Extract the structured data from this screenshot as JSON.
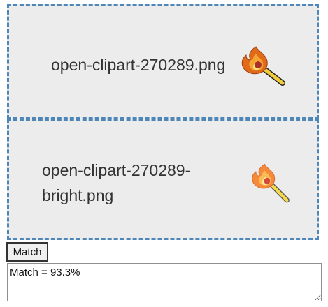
{
  "zones": [
    {
      "filename": "open-clipart-270289.png",
      "thumb_icon": "burning-match-icon"
    },
    {
      "filename": "open-clipart-270289-bright.png",
      "thumb_icon": "burning-match-bright-icon"
    }
  ],
  "button": {
    "label": "Match"
  },
  "result": {
    "value": "Match = 93.3%"
  },
  "colors": {
    "dropzone_border": "#4f86b8",
    "dropzone_bg": "#ececec"
  }
}
